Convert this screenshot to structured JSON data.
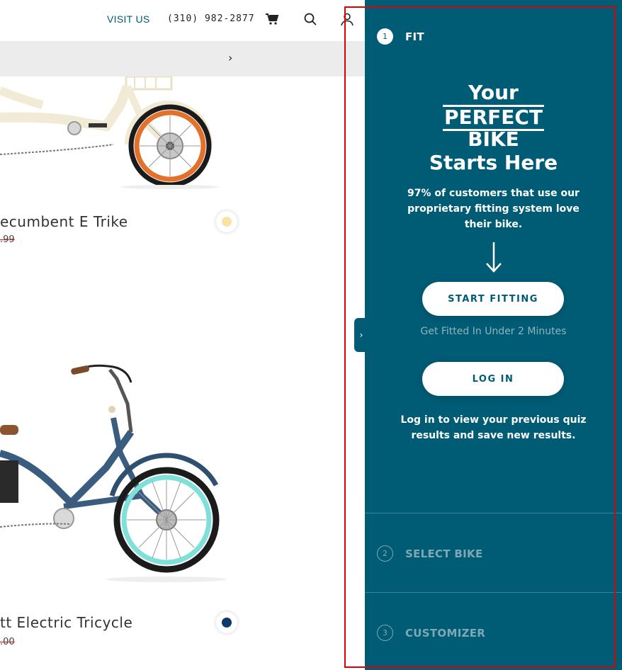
{
  "header": {
    "visit_label": "VISIT US",
    "phone": "(310) 982-2877",
    "icons": {
      "cart": "cart-icon",
      "search": "search-icon",
      "account": "user-icon"
    }
  },
  "promo_bar": {
    "chevron": "›"
  },
  "products": [
    {
      "name": "ecumbent E Trike",
      "price": ".99",
      "swatch_color": "#f7e3a6"
    },
    {
      "name": "tt Electric Tricycle",
      "price": ".00",
      "swatch_color": "#0e3a6b"
    }
  ],
  "panel": {
    "toggle": "›",
    "steps": [
      {
        "num": "1",
        "label": "FIT"
      },
      {
        "num": "2",
        "label": "SELECT BIKE"
      },
      {
        "num": "3",
        "label": "CUSTOMIZER"
      }
    ],
    "hero": {
      "line1": "Your",
      "line2": "PERFECT",
      "line3": "BIKE",
      "line4": "Starts Here"
    },
    "description": "97% of customers that use our proprietary fitting system love their bike.",
    "start_button": "START FITTING",
    "fit_note": "Get Fitted In Under 2 Minutes",
    "login_button": "LOG IN",
    "login_note": "Log in to view your previous quiz results and save new results.",
    "colors": {
      "panel_bg": "#005b74",
      "accent_text": "#005a73",
      "frame": "#e00000"
    }
  }
}
